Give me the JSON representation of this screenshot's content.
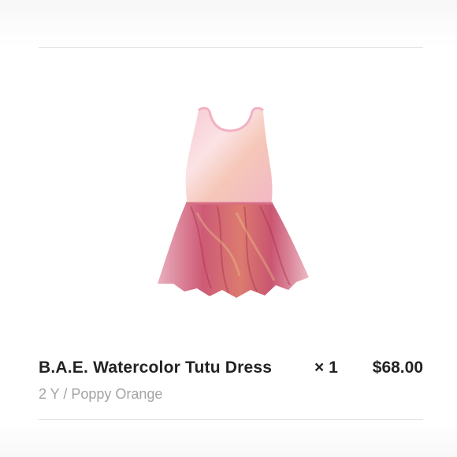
{
  "cart_item": {
    "title": "B.A.E. Watercolor Tutu Dress",
    "quantity": "× 1",
    "price": "$68.00",
    "variant": "2 Y / Poppy Orange",
    "image_icon": "tutu-dress-product-image"
  },
  "colors": {
    "text": "#222222",
    "muted": "#a3a3a3",
    "divider": "#e3e3e3"
  }
}
